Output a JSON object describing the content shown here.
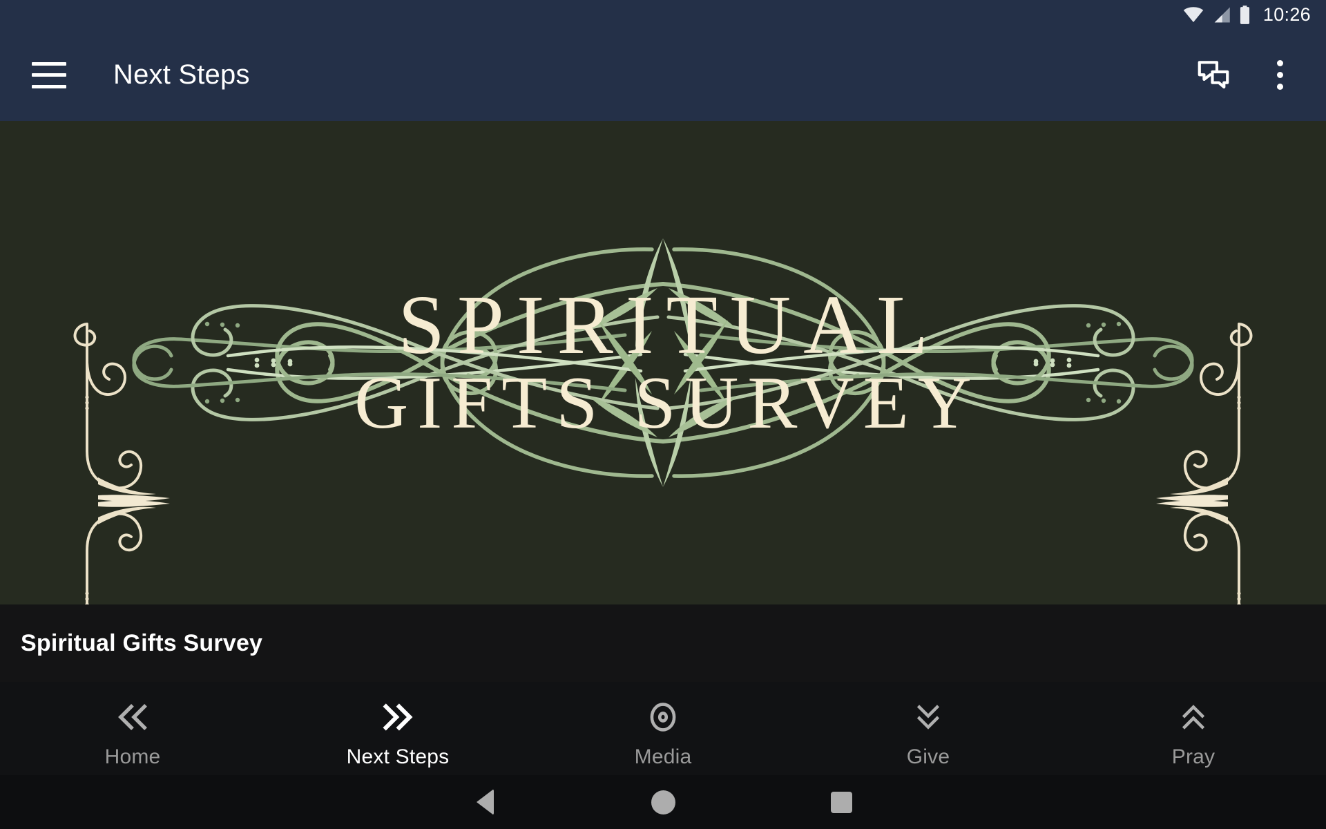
{
  "statusbar": {
    "time": "10:26",
    "icons": [
      "wifi-icon",
      "cellular-signal-icon",
      "battery-icon"
    ]
  },
  "appbar": {
    "menu_icon": "hamburger-menu-icon",
    "title": "Next Steps",
    "actions": [
      {
        "name": "messages-icon",
        "label": "Messages"
      },
      {
        "name": "overflow-menu-icon",
        "label": "More options"
      }
    ],
    "background_color": "#243048"
  },
  "banner": {
    "title_line1": "SPIRITUAL",
    "title_line2": "GIFTS SURVEY",
    "background_color": "#262b20",
    "title_color": "#f6ecd2",
    "flourish_color": "#a9c09a",
    "side_ornament_color": "#ece2c8"
  },
  "caption": {
    "text": "Spiritual Gifts Survey",
    "background_color": "#141415"
  },
  "bottom_nav": {
    "items": [
      {
        "label": "Home",
        "icon": "double-chevron-left-icon",
        "active": false
      },
      {
        "label": "Next Steps",
        "icon": "double-chevron-right-icon",
        "active": true
      },
      {
        "label": "Media",
        "icon": "circle-dot-icon",
        "active": false
      },
      {
        "label": "Give",
        "icon": "double-chevron-down-icon",
        "active": false
      },
      {
        "label": "Pray",
        "icon": "double-chevron-up-icon",
        "active": false
      }
    ],
    "active_color": "#ffffff",
    "inactive_color": "#9a9a9a",
    "background_color": "#111214"
  },
  "system_nav": {
    "back": "back-triangle-icon",
    "home": "home-circle-icon",
    "recents": "recents-square-icon"
  }
}
